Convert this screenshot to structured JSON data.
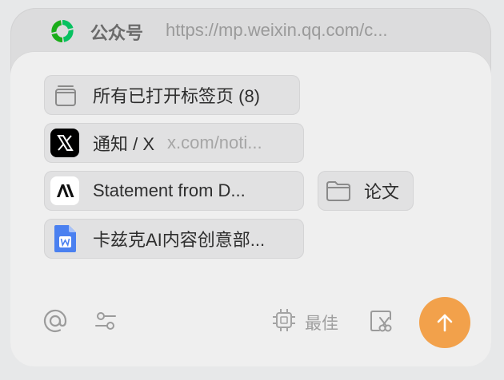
{
  "source": {
    "name": "公众号",
    "url": "https://mp.weixin.qq.com/c...",
    "icon": "wechat-logo-icon"
  },
  "chips": {
    "all_tabs": {
      "label": "所有已打开标签页 (8)",
      "icon": "tabs-stack-icon"
    },
    "x_notifications": {
      "label": "通知 / X",
      "sub": "x.com/noti...",
      "icon": "x-logo-icon"
    },
    "anthropic": {
      "label": "Statement from D...",
      "icon": "anthropic-logo-icon"
    },
    "papers_folder": {
      "label": "论文",
      "icon": "folder-icon"
    },
    "doc": {
      "label": "卡兹克AI内容创意部...",
      "icon": "word-doc-icon"
    }
  },
  "footer": {
    "mention_icon": "at-icon",
    "settings_icon": "sliders-icon",
    "model_icon": "chip-icon",
    "model_label": "最佳",
    "screenshot_icon": "screenshot-crop-icon",
    "send_icon": "arrow-up-icon"
  },
  "colors": {
    "accent": "#f2a14b",
    "wechat_green": "#07c160",
    "doc_blue": "#4a80f0"
  }
}
